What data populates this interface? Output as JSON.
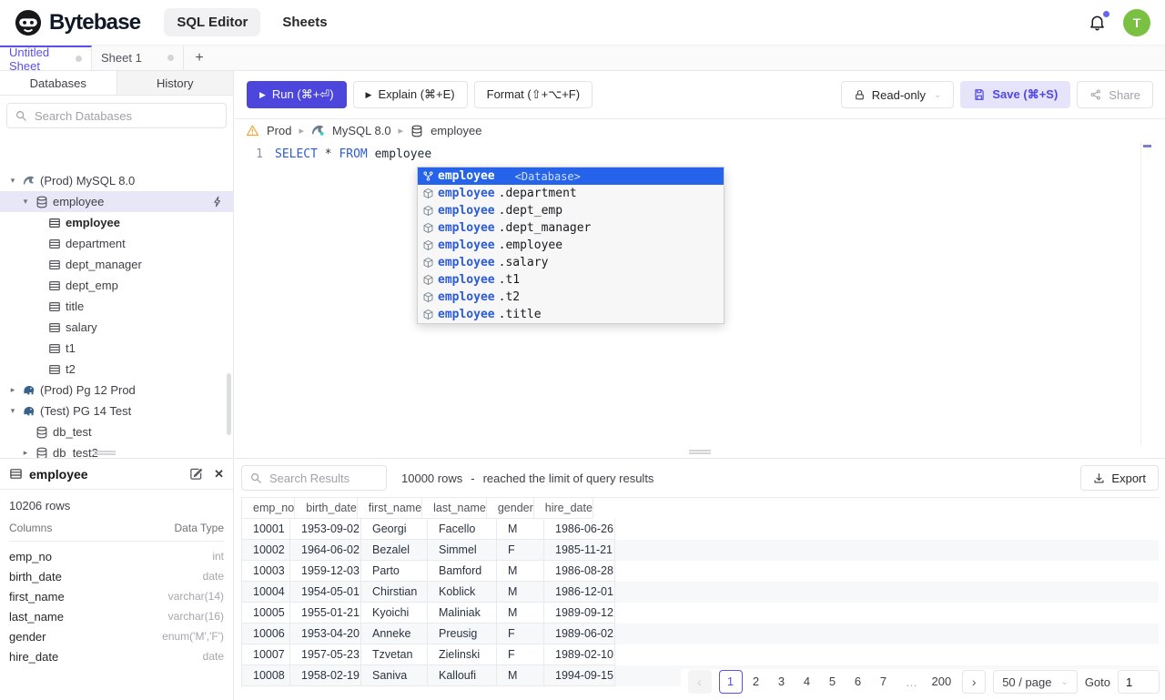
{
  "colors": {
    "accent": "#4f46e5",
    "run_button": "#4d46dc",
    "autocomplete_selected": "#2563eb",
    "sql_keyword": "#2b5bd7",
    "avatar_green": "#7ac143",
    "warning_amber": "#f59e0b",
    "notification_badge": "#6366f1",
    "tree_selected_bg": "#e7e7f7"
  },
  "icons": {
    "plus": "+",
    "close": "✕",
    "chevron_down": "⌄",
    "caret_down": "▾",
    "caret_right": "▸",
    "play": "▶",
    "prev": "‹",
    "next": "›",
    "ellipsis": "…"
  },
  "header": {
    "brand": "Bytebase",
    "nav_sql_editor": "SQL Editor",
    "nav_sheets": "Sheets",
    "avatar": "T"
  },
  "sheet_tabs": {
    "active": "Untitled Sheet",
    "inactive": "Sheet 1"
  },
  "sidebar": {
    "tab_databases": "Databases",
    "tab_history": "History",
    "search_placeholder": "Search Databases",
    "tree": [
      "(Prod) MySQL 8.0",
      "employee",
      "employee",
      "department",
      "dept_manager",
      "dept_emp",
      "title",
      "salary",
      "t1",
      "t2",
      "(Prod) Pg 12 Prod",
      "(Test) PG 14 Test",
      "db_test",
      "db_test2"
    ]
  },
  "schema_panel": {
    "table": "employee",
    "row_count": "10206 rows",
    "columns_label": "Columns",
    "datatype_label": "Data Type",
    "columns": [
      {
        "name": "emp_no",
        "type": "int"
      },
      {
        "name": "birth_date",
        "type": "date"
      },
      {
        "name": "first_name",
        "type": "varchar(14)"
      },
      {
        "name": "last_name",
        "type": "varchar(16)"
      },
      {
        "name": "gender",
        "type": "enum('M','F')"
      },
      {
        "name": "hire_date",
        "type": "date"
      }
    ]
  },
  "toolbar": {
    "run": "Run (⌘+⏎)",
    "explain": "Explain (⌘+E)",
    "format": "Format (⇧+⌥+F)",
    "readonly": "Read-only",
    "save": "Save (⌘+S)",
    "share": "Share"
  },
  "breadcrumb": {
    "environment": "Prod",
    "instance": "MySQL 8.0",
    "database": "employee"
  },
  "editor": {
    "line_number": "1",
    "kw_select": "SELECT",
    "star": "*",
    "kw_from": "FROM",
    "identifier": "employee"
  },
  "autocomplete": {
    "items": [
      {
        "prefix": "employee",
        "suffix": "",
        "detail": "<Database>",
        "selected": true
      },
      {
        "prefix": "employee",
        "suffix": ".department"
      },
      {
        "prefix": "employee",
        "suffix": ".dept_emp"
      },
      {
        "prefix": "employee",
        "suffix": ".dept_manager"
      },
      {
        "prefix": "employee",
        "suffix": ".employee"
      },
      {
        "prefix": "employee",
        "suffix": ".salary"
      },
      {
        "prefix": "employee",
        "suffix": ".t1"
      },
      {
        "prefix": "employee",
        "suffix": ".t2"
      },
      {
        "prefix": "employee",
        "suffix": ".title"
      }
    ]
  },
  "results": {
    "search_placeholder": "Search Results",
    "row_count": "10000 rows",
    "dash": "-",
    "limit_note": "reached the limit of query results",
    "export_label": "Export",
    "headers": [
      "emp_no",
      "birth_date",
      "first_name",
      "last_name",
      "gender",
      "hire_date"
    ],
    "rows": [
      [
        "10001",
        "1953-09-02",
        "Georgi",
        "Facello",
        "M",
        "1986-06-26"
      ],
      [
        "10002",
        "1964-06-02",
        "Bezalel",
        "Simmel",
        "F",
        "1985-11-21"
      ],
      [
        "10003",
        "1959-12-03",
        "Parto",
        "Bamford",
        "M",
        "1986-08-28"
      ],
      [
        "10004",
        "1954-05-01",
        "Chirstian",
        "Koblick",
        "M",
        "1986-12-01"
      ],
      [
        "10005",
        "1955-01-21",
        "Kyoichi",
        "Maliniak",
        "M",
        "1989-09-12"
      ],
      [
        "10006",
        "1953-04-20",
        "Anneke",
        "Preusig",
        "F",
        "1989-06-02"
      ],
      [
        "10007",
        "1957-05-23",
        "Tzvetan",
        "Zielinski",
        "F",
        "1989-02-10"
      ],
      [
        "10008",
        "1958-02-19",
        "Saniva",
        "Kalloufi",
        "M",
        "1994-09-15"
      ]
    ],
    "pagination": {
      "pages": [
        {
          "label": "1",
          "active": true
        },
        {
          "label": "2"
        },
        {
          "label": "3"
        },
        {
          "label": "4"
        },
        {
          "label": "5"
        },
        {
          "label": "6"
        },
        {
          "label": "7"
        }
      ],
      "last_page": "200",
      "page_size": "50 / page",
      "goto_label": "Goto",
      "goto_value": "1"
    }
  }
}
